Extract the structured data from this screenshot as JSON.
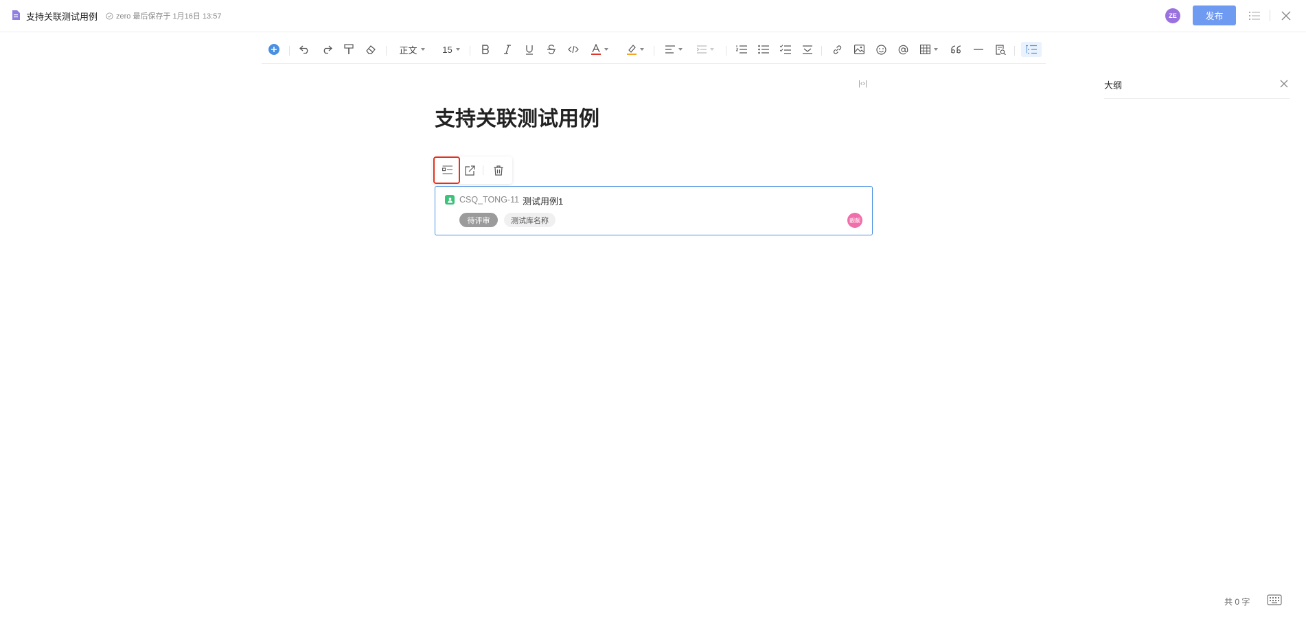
{
  "header": {
    "doc_title": "支持关联测试用例",
    "save_status": "zero 最后保存于 1月16日 13:57",
    "user_avatar": "ZE",
    "publish_label": "发布"
  },
  "toolbar": {
    "paragraph_style": "正文",
    "font_size": "15",
    "icons": [
      "plus-circle-icon",
      "undo-icon",
      "redo-icon",
      "format-painter-icon",
      "eraser-icon",
      "bold-icon",
      "italic-icon",
      "underline-icon",
      "strikethrough-icon",
      "code-icon",
      "font-color-icon",
      "highlight-icon",
      "align-icon",
      "indent-icon",
      "ordered-list-icon",
      "bullet-list-icon",
      "task-list-icon",
      "collapse-icon",
      "link-icon",
      "image-icon",
      "emoji-icon",
      "mention-icon",
      "table-icon",
      "quote-icon",
      "divider-icon",
      "search-doc-icon",
      "outline-toggle-icon"
    ],
    "colors": {
      "accent": "#4a90e2",
      "font_color": "#e0372b",
      "highlight": "#f5a623"
    }
  },
  "editor": {
    "title": "支持关联测试用例",
    "embed_marker": "|‹›|"
  },
  "float_toolbar": {
    "icons": [
      "card-view-icon",
      "open-external-icon",
      "delete-icon"
    ]
  },
  "test_case": {
    "id": "CSQ_TONG-11",
    "name": "测试用例1",
    "status": "待评审",
    "repository": "测试库名称",
    "assignee": "靓靓",
    "colors": {
      "status": "#9b9b9b",
      "icon": "#3cc27a",
      "avatar": "#f06ea9",
      "border": "#4a90e2"
    }
  },
  "outline": {
    "title": "大纲"
  },
  "footer": {
    "word_count": "共 0 字"
  }
}
